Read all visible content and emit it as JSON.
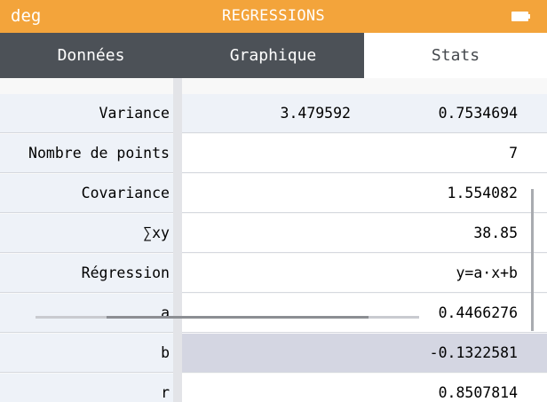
{
  "header": {
    "angle_mode": "deg",
    "title": "REGRESSIONS",
    "battery_icon": "battery-full-icon"
  },
  "tabs": [
    {
      "label": "Données",
      "active": false
    },
    {
      "label": "Graphique",
      "active": false
    },
    {
      "label": "Stats",
      "active": true
    }
  ],
  "stats_rows": [
    {
      "label": "Variance",
      "v1": "3.479592",
      "v2": "0.7534694"
    },
    {
      "label": "Nombre de points",
      "v1": "",
      "v2": "7"
    },
    {
      "label": "Covariance",
      "v1": "",
      "v2": "1.554082"
    },
    {
      "label": "∑xy",
      "v1": "",
      "v2": "38.85"
    },
    {
      "label": "Régression",
      "v1": "",
      "v2": "y=a·x+b"
    },
    {
      "label": "a",
      "v1": "",
      "v2": "0.4466276"
    },
    {
      "label": "b",
      "v1": "",
      "v2": "-0.1322581",
      "selected": true
    },
    {
      "label": "r",
      "v1": "",
      "v2": "0.8507814"
    }
  ],
  "colors": {
    "title_bar": "#f3a43b",
    "tab_bar": "#4c5157",
    "selected_row": "#d4d6e2",
    "label_column": "#eef2f8"
  }
}
